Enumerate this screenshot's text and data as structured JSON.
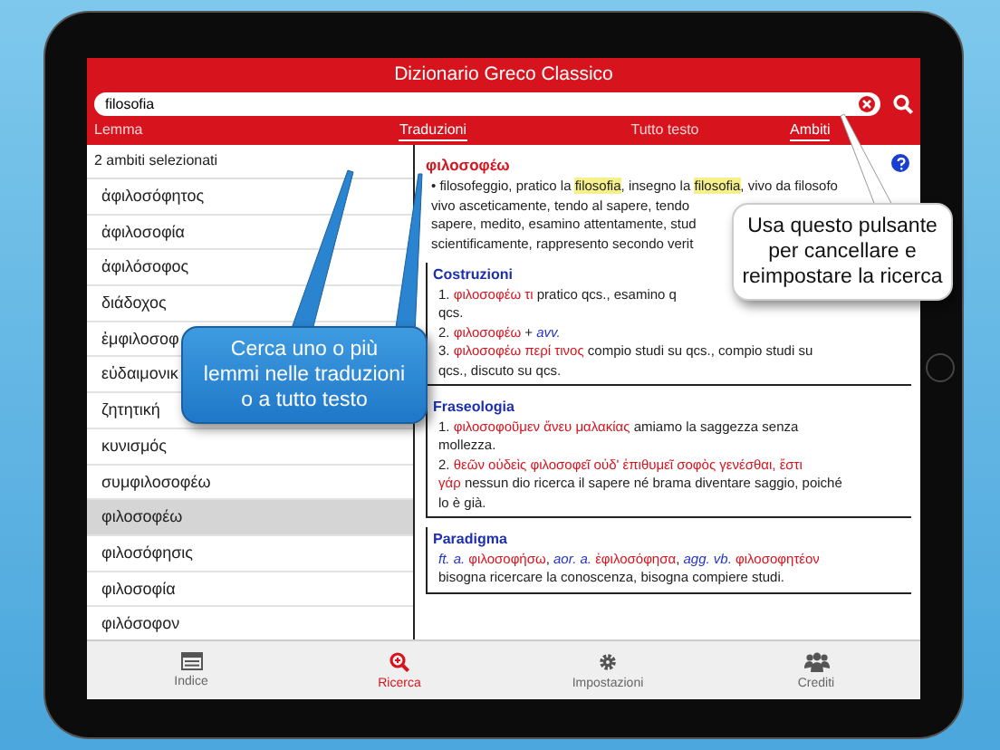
{
  "app": {
    "title": "Dizionario Greco Classico"
  },
  "search": {
    "value": "filosofia"
  },
  "scopes": [
    {
      "label": "Lemma",
      "selected": false
    },
    {
      "label": "Traduzioni",
      "selected": true
    },
    {
      "label": "Tutto testo",
      "selected": false
    },
    {
      "label": "Ambiti",
      "selected": true
    }
  ],
  "results": {
    "header": "2 ambiti selezionati",
    "items": [
      {
        "label": "ἀφιλοσόφητος",
        "selected": false
      },
      {
        "label": "ἀφιλοσοφία",
        "selected": false
      },
      {
        "label": "ἀφιλόσοφος",
        "selected": false
      },
      {
        "label": "διάδοχος",
        "selected": false
      },
      {
        "label": "ἐμφιλοσοφ",
        "selected": false
      },
      {
        "label": "εὐδαιμονικ",
        "selected": false
      },
      {
        "label": "ζητητική",
        "selected": false
      },
      {
        "label": "κυνισμός",
        "selected": false
      },
      {
        "label": "συμφιλοσοφέω",
        "selected": false
      },
      {
        "label": "φιλοσοφέω",
        "selected": true
      },
      {
        "label": "φιλοσόφησις",
        "selected": false
      },
      {
        "label": "φιλοσοφία",
        "selected": false
      },
      {
        "label": "φιλόσοφον",
        "selected": false
      }
    ]
  },
  "entry": {
    "headword": "φιλοσοφέω",
    "lines": [
      [
        {
          "kind": "text",
          "text": "• filosofeggio, pratico la "
        },
        {
          "kind": "hit",
          "text": "filosofia"
        },
        {
          "kind": "text",
          "text": ", insegno la "
        },
        {
          "kind": "hit",
          "text": "filosofia"
        },
        {
          "kind": "text",
          "text": ", vivo da filosofo"
        }
      ],
      [
        {
          "kind": "text",
          "text": "vivo asceticamente, tendo al sapere, tendo"
        }
      ],
      [
        {
          "kind": "text",
          "text": "sapere, medito, esamino attentamente, stud"
        }
      ],
      [
        {
          "kind": "text",
          "text": "scientificamente, rappresento secondo verit"
        }
      ]
    ],
    "sections": [
      {
        "title": "Costruzioni",
        "lines": [
          [
            {
              "kind": "text",
              "text": "1. "
            },
            {
              "kind": "greek",
              "text": "φιλοσοφέω τι"
            },
            {
              "kind": "text",
              "text": " pratico qcs., esamino q"
            }
          ],
          [
            {
              "kind": "text",
              "text": "qcs."
            }
          ],
          [
            {
              "kind": "text",
              "text": "2. "
            },
            {
              "kind": "greek",
              "text": "φιλοσοφέω"
            },
            {
              "kind": "text",
              "text": " + "
            },
            {
              "kind": "abbr",
              "text": "avv."
            }
          ],
          [
            {
              "kind": "text",
              "text": "3. "
            },
            {
              "kind": "greek",
              "text": "φιλοσοφέω περί τινος"
            },
            {
              "kind": "text",
              "text": " compio studi su qcs., compio studi su"
            }
          ],
          [
            {
              "kind": "text",
              "text": "qcs., discuto su qcs."
            }
          ]
        ]
      },
      {
        "title": "Fraseologia",
        "lines": [
          [
            {
              "kind": "text",
              "text": "1. "
            },
            {
              "kind": "greek",
              "text": "φιλοσοφοῦμεν ἄνευ μαλακίας"
            },
            {
              "kind": "text",
              "text": " amiamo la saggezza senza"
            }
          ],
          [
            {
              "kind": "text",
              "text": "mollezza."
            }
          ],
          [
            {
              "kind": "text",
              "text": "2. "
            },
            {
              "kind": "greek",
              "text": "θεῶν οὐδεὶς φιλοσοφεῖ οὐδ' ἐπιθυμεῖ σοφὸς γενέσθαι, ἔστι"
            }
          ],
          [
            {
              "kind": "greek",
              "text": "γάρ"
            },
            {
              "kind": "text",
              "text": " nessun dio ricerca il sapere né brama diventare saggio, poiché"
            }
          ],
          [
            {
              "kind": "text",
              "text": "lo è già."
            }
          ]
        ]
      },
      {
        "title": "Paradigma",
        "lines": [
          [
            {
              "kind": "abbr",
              "text": "ft. a."
            },
            {
              "kind": "greek",
              "text": " φιλοσοφήσω"
            },
            {
              "kind": "text",
              "text": ", "
            },
            {
              "kind": "abbr",
              "text": "aor. a."
            },
            {
              "kind": "greek",
              "text": " ἐφιλοσόφησα"
            },
            {
              "kind": "text",
              "text": ", "
            },
            {
              "kind": "abbr",
              "text": "agg. vb."
            },
            {
              "kind": "greek",
              "text": " φιλοσοφητέον"
            }
          ],
          [
            {
              "kind": "text",
              "text": "bisogna ricercare la conoscenza, bisogna compiere studi."
            }
          ]
        ]
      }
    ]
  },
  "tabs": [
    {
      "label": "Indice",
      "kind": "index",
      "selected": false
    },
    {
      "label": "Ricerca",
      "kind": "search",
      "selected": true
    },
    {
      "label": "Impostazioni",
      "kind": "settings",
      "selected": false
    },
    {
      "label": "Crediti",
      "kind": "people",
      "selected": false
    }
  ],
  "callouts": [
    {
      "kind": "blue",
      "lines": [
        "Cerca uno o più",
        "lemmi nelle traduzioni",
        "o a tutto testo"
      ]
    },
    {
      "kind": "white",
      "lines": [
        "Usa questo pulsante",
        "per cancellare e",
        "reimpostare la ricerca"
      ]
    }
  ]
}
